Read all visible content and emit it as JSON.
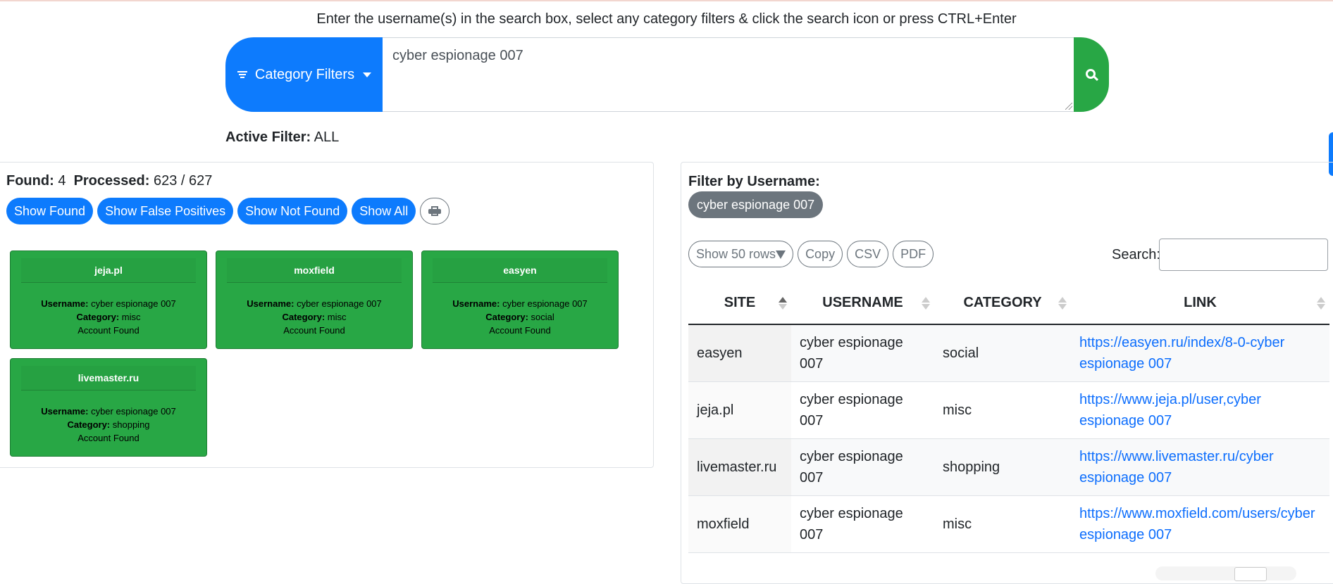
{
  "instructions": "Enter the username(s) in the search box, select any category filters & click the search icon or press CTRL+Enter",
  "search": {
    "category_button": "Category Filters",
    "query": "cyber espionage 007"
  },
  "active_filter": {
    "label": "Active Filter:",
    "value": "ALL"
  },
  "stats": {
    "found_label": "Found:",
    "found": "4",
    "processed_label": "Processed:",
    "processed": "623 / 627"
  },
  "result_buttons": [
    "Show Found",
    "Show False Positives",
    "Show Not Found",
    "Show All"
  ],
  "cards": [
    {
      "site": "jeja.pl",
      "username_label": "Username:",
      "username": "cyber espionage 007",
      "category_label": "Category:",
      "category": "misc",
      "status": "Account Found"
    },
    {
      "site": "moxfield",
      "username_label": "Username:",
      "username": "cyber espionage 007",
      "category_label": "Category:",
      "category": "misc",
      "status": "Account Found"
    },
    {
      "site": "easyen",
      "username_label": "Username:",
      "username": "cyber espionage 007",
      "category_label": "Category:",
      "category": "social",
      "status": "Account Found"
    },
    {
      "site": "livemaster.ru",
      "username_label": "Username:",
      "username": "cyber espionage 007",
      "category_label": "Category:",
      "category": "shopping",
      "status": "Account Found"
    }
  ],
  "right": {
    "filter_label": "Filter by Username:",
    "username_chip": "cyber espionage 007",
    "show_rows": "Show 50 rows",
    "tools": [
      "Copy",
      "CSV",
      "PDF"
    ],
    "search_label": "Search:",
    "columns": [
      "SITE",
      "USERNAME",
      "CATEGORY",
      "LINK"
    ],
    "rows": [
      {
        "site": "easyen",
        "username": "cyber espionage 007",
        "category": "social",
        "link": "https://easyen.ru/index/8-0-cyber espionage 007"
      },
      {
        "site": "jeja.pl",
        "username": "cyber espionage 007",
        "category": "misc",
        "link": "https://www.jeja.pl/user,cyber espionage 007"
      },
      {
        "site": "livemaster.ru",
        "username": "cyber espionage 007",
        "category": "shopping",
        "link": "https://www.livemaster.ru/cyber espionage 007"
      },
      {
        "site": "moxfield",
        "username": "cyber espionage 007",
        "category": "misc",
        "link": "https://www.moxfield.com/users/cyber espionage 007"
      }
    ]
  },
  "colors": {
    "primary": "#0d7bfd",
    "success": "#28a745",
    "secondary": "#6c757d"
  }
}
